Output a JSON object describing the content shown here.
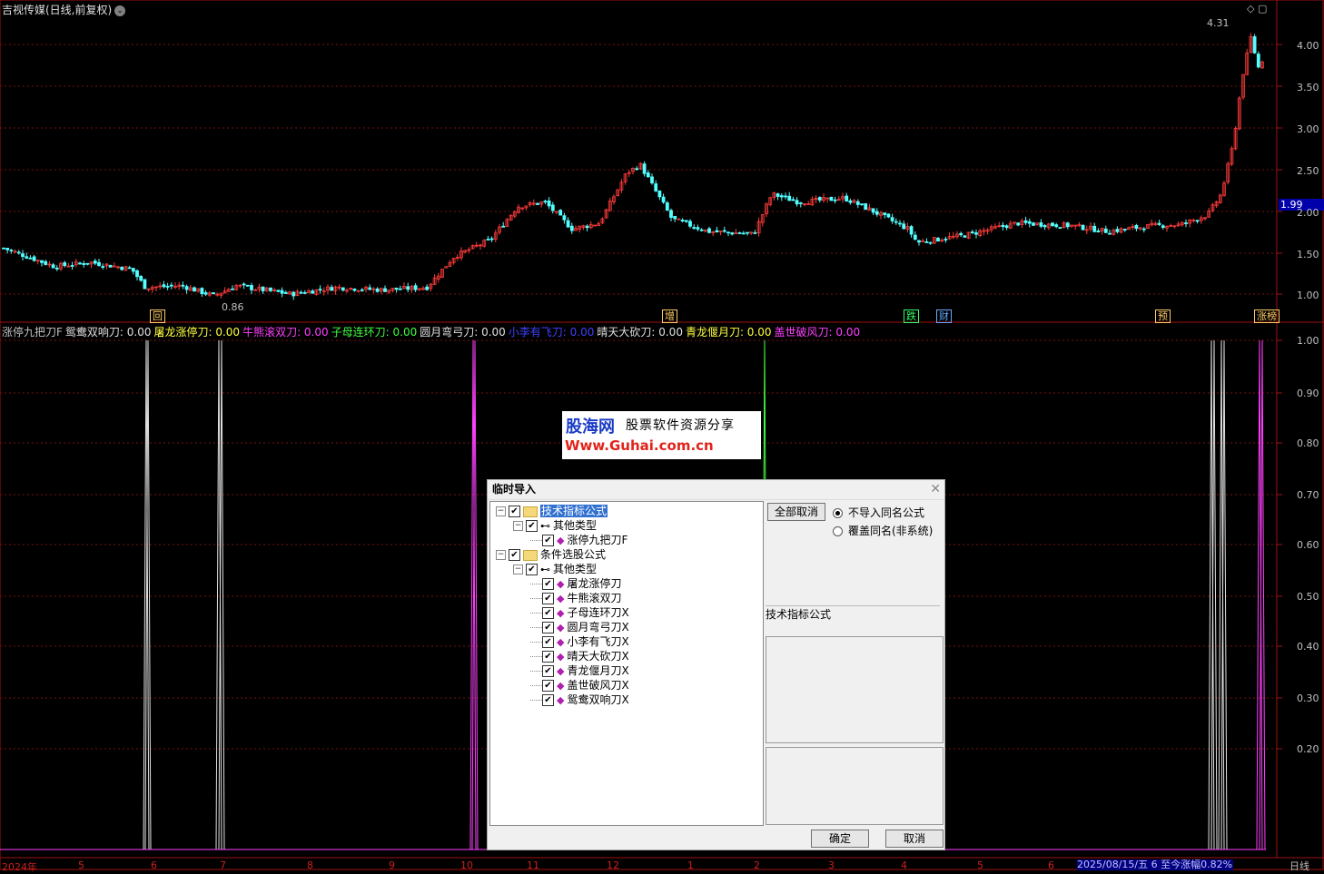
{
  "window": {
    "stock_title": "吉视传媒(日线,前复权)",
    "title_btn_glyph": "⌄",
    "top_icons": "◇ ▢"
  },
  "price_axis": {
    "labels": [
      "4.00",
      "3.50",
      "3.00",
      "2.50",
      "2.00",
      "1.50",
      "1.00"
    ],
    "current_price": "1.99",
    "high_label": "4.31",
    "low_label": "0.86"
  },
  "event_tags": [
    {
      "text": "回",
      "color": "#ffcc66"
    },
    {
      "text": "增",
      "color": "#ffcc66"
    },
    {
      "text": "跌",
      "color": "#33ff66"
    },
    {
      "text": "财",
      "color": "#66aaff"
    },
    {
      "text": "预",
      "color": "#ffcc66"
    },
    {
      "text": "涨榜",
      "color": "#ffcc66"
    }
  ],
  "indicator": {
    "name": "涨停九把刀F",
    "items": [
      {
        "label": "鸳鸯双响刀: 0.00",
        "color": "#e0e0e0"
      },
      {
        "label": "屠龙涨停刀: 0.00",
        "color": "#ffff40"
      },
      {
        "label": "牛熊滚双刀: 0.00",
        "color": "#ff40ff"
      },
      {
        "label": "子母连环刀: 0.00",
        "color": "#40ff40"
      },
      {
        "label": "圆月弯弓刀: 0.00",
        "color": "#e0e0e0"
      },
      {
        "label": "小李有飞刀: 0.00",
        "color": "#4040ff"
      },
      {
        "label": "晴天大砍刀: 0.00",
        "color": "#e0e0e0"
      },
      {
        "label": "青龙偃月刀: 0.00",
        "color": "#ffff40"
      },
      {
        "label": "盖世破风刀: 0.00",
        "color": "#ff40ff"
      }
    ],
    "axis_labels": [
      "1.00",
      "0.90",
      "0.80",
      "0.70",
      "0.60",
      "0.50",
      "0.40",
      "0.30",
      "0.20"
    ]
  },
  "timeline": {
    "labels": [
      "2024年",
      "5",
      "6",
      "7",
      "8",
      "9",
      "10",
      "11",
      "12",
      "1",
      "2",
      "3",
      "4",
      "5",
      "6"
    ],
    "status": "2025/08/15/五 6 至今涨幅0.82%",
    "period": "日线"
  },
  "banner": {
    "brand": "股海网",
    "slogan": "股票软件资源分享",
    "url": "Www.Guhai.com.cn"
  },
  "dialog": {
    "title": "临时导入",
    "close_glyph": "✕",
    "tree": [
      {
        "level": 0,
        "kind": "folder",
        "label": "技术指标公式",
        "selected": true
      },
      {
        "level": 1,
        "kind": "key",
        "label": "其他类型"
      },
      {
        "level": 2,
        "kind": "item",
        "label": "涨停九把刀F"
      },
      {
        "level": 0,
        "kind": "folder",
        "label": "条件选股公式"
      },
      {
        "level": 1,
        "kind": "key",
        "label": "其他类型"
      },
      {
        "level": 2,
        "kind": "item",
        "label": "屠龙涨停刀"
      },
      {
        "level": 2,
        "kind": "item",
        "label": "牛熊滚双刀"
      },
      {
        "level": 2,
        "kind": "item",
        "label": "子母连环刀X"
      },
      {
        "level": 2,
        "kind": "item",
        "label": "圆月弯弓刀X"
      },
      {
        "level": 2,
        "kind": "item",
        "label": "小李有飞刀X"
      },
      {
        "level": 2,
        "kind": "item",
        "label": "晴天大砍刀X"
      },
      {
        "level": 2,
        "kind": "item",
        "label": "青龙偃月刀X"
      },
      {
        "level": 2,
        "kind": "item",
        "label": "盖世破风刀X"
      },
      {
        "level": 2,
        "kind": "item",
        "label": "鸳鸯双响刀X"
      }
    ],
    "cancel_all_label": "全部取消",
    "radio_no_import": "不导入同名公式",
    "radio_overwrite": "覆盖同名(非系统)",
    "panel_label": "技术指标公式",
    "ok_label": "确定",
    "cancel_label": "取消"
  }
}
